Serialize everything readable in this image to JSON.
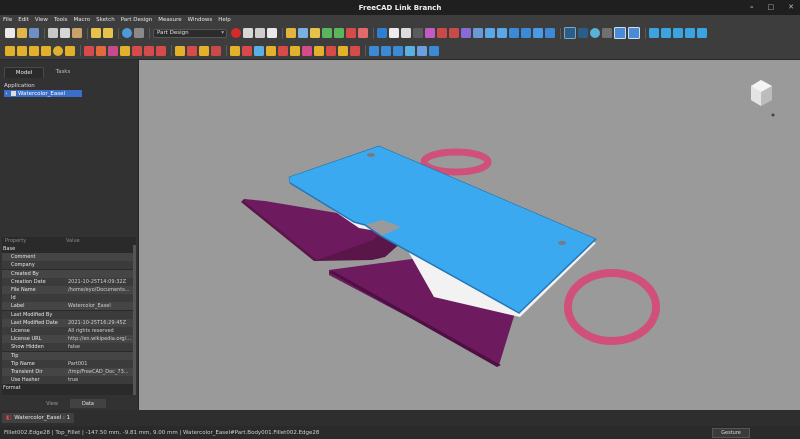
{
  "window": {
    "title": "FreeCAD Link Branch",
    "controls": [
      "–",
      "□",
      "✕"
    ]
  },
  "menu": [
    "File",
    "Edit",
    "View",
    "Tools",
    "Macro",
    "Sketch",
    "Part Design",
    "Measure",
    "Windows",
    "Help"
  ],
  "toolbar": {
    "workbench": "Part Design"
  },
  "combo_view": {
    "tabs": [
      "Model",
      "Tasks"
    ],
    "active_tab": "Model",
    "tree_header": "Application",
    "document": "Watercolor_Easel"
  },
  "property_view": {
    "columns": [
      "Property",
      "Value"
    ],
    "rows": [
      {
        "group": "Base"
      },
      {
        "name": "Comment",
        "value": ""
      },
      {
        "name": "Company",
        "value": ""
      },
      {
        "name": "Created By",
        "value": ""
      },
      {
        "name": "Creation Date",
        "value": "2021-10-25T14:09:32Z"
      },
      {
        "name": "File Name",
        "value": "/home/eyo/Documents..."
      },
      {
        "name": "Id",
        "value": ""
      },
      {
        "name": "Label",
        "value": "Watercolor_Easel"
      },
      {
        "name": "Last Modified By",
        "value": ""
      },
      {
        "name": "Last Modified Date",
        "value": "2021-10-25T16:29:45Z"
      },
      {
        "name": "License",
        "value": "All rights reserved"
      },
      {
        "name": "License URL",
        "value": "http://en.wikipedia.org/..."
      },
      {
        "name": "Show Hidden",
        "value": "false"
      },
      {
        "name": "Tip",
        "value": ""
      },
      {
        "name": "Tip Name",
        "value": "Part001"
      },
      {
        "name": "Transient Dir",
        "value": "/tmp/FreeCAD_Doc_73..."
      },
      {
        "name": "Use Hasher",
        "value": "true"
      },
      {
        "group": "Format"
      }
    ],
    "tabs": [
      "View",
      "Data"
    ],
    "active_tab": "Data"
  },
  "document_tab": {
    "label": "Watercolor_Easel : 1"
  },
  "status": {
    "text": "Fillet002.Edge28 | Top_Fillet | -147.50 mm, -9.81 mm, 9.00 mm | Watercolor_Easel#Part.Body001.Fillet002.Edge28",
    "navigation": "Gesture"
  },
  "colors": {
    "top_plate": "#3aa9ef",
    "purple_plate": "#6e1a5e",
    "ring": "#d0507a",
    "background": "#9a9a9a",
    "selection": "#3a6ec8"
  }
}
